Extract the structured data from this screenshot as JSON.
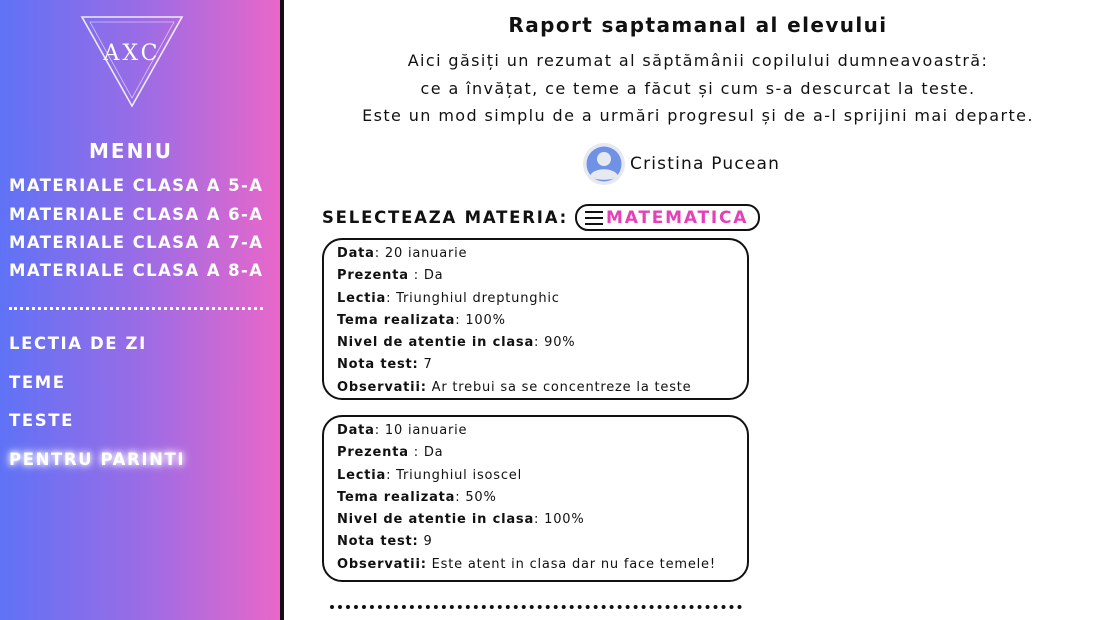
{
  "sidebar": {
    "logo_text": "AXC",
    "menu_title": "MENIU",
    "grades": [
      "MATERIALE CLASA A 5-A",
      "MATERIALE CLASA A 6-A",
      "MATERIALE CLASA A 7-A",
      "MATERIALE CLASA A 8-A"
    ],
    "nav": [
      "LECTIA DE ZI",
      "TEME",
      "TESTE",
      "PENTRU PARINTI"
    ],
    "active_item": "PENTRU PARINTI"
  },
  "main": {
    "title": "Raport saptamanal al elevului",
    "intro": [
      "Aici găsiți un rezumat al săptămânii copilului dumneavoastră:",
      "ce a învățat, ce teme a făcut și cum s-a descurcat la teste.",
      "Este un mod simplu de a urmări progresul și de a-l sprijini mai departe."
    ],
    "student_name": "Cristina Pucean",
    "subject_label": "SELECTEAZA MATERIA:",
    "subject_value": "MATEMATICA",
    "reports": [
      {
        "data_label": "Data",
        "data_value": ": 20 ianuarie",
        "prezenta_label": "Prezenta",
        "prezenta_value": " : Da",
        "lectia_label": "Lectia",
        "lectia_value": ": Triunghiul dreptunghic",
        "tema_label": "Tema realizata",
        "tema_value": ": 100%",
        "atentie_label": "Nivel de atentie in clasa",
        "atentie_value": ": 90%",
        "nota_label": "Nota test:",
        "nota_value": " 7",
        "obs_label": "Observatii:",
        "obs_value": " Ar trebui sa se concentreze la teste"
      },
      {
        "data_label": "Data",
        "data_value": ": 10 ianuarie",
        "prezenta_label": "Prezenta",
        "prezenta_value": " : Da",
        "lectia_label": "Lectia",
        "lectia_value": ": Triunghiul isoscel",
        "tema_label": "Tema realizata",
        "tema_value": ": 50%",
        "atentie_label": "Nivel de atentie in clasa",
        "atentie_value": ": 100%",
        "nota_label": "Nota test:",
        "nota_value": " 9",
        "obs_label": "Observatii:",
        "obs_value": " Este atent in clasa dar nu face temele!"
      }
    ]
  },
  "colors": {
    "sidebar_gradient_start": "#5f72f6",
    "sidebar_gradient_end": "#e967c9",
    "subject_accent": "#e640b8"
  },
  "icons": [
    "logo-triangle-icon",
    "avatar-icon",
    "hamburger-icon"
  ]
}
